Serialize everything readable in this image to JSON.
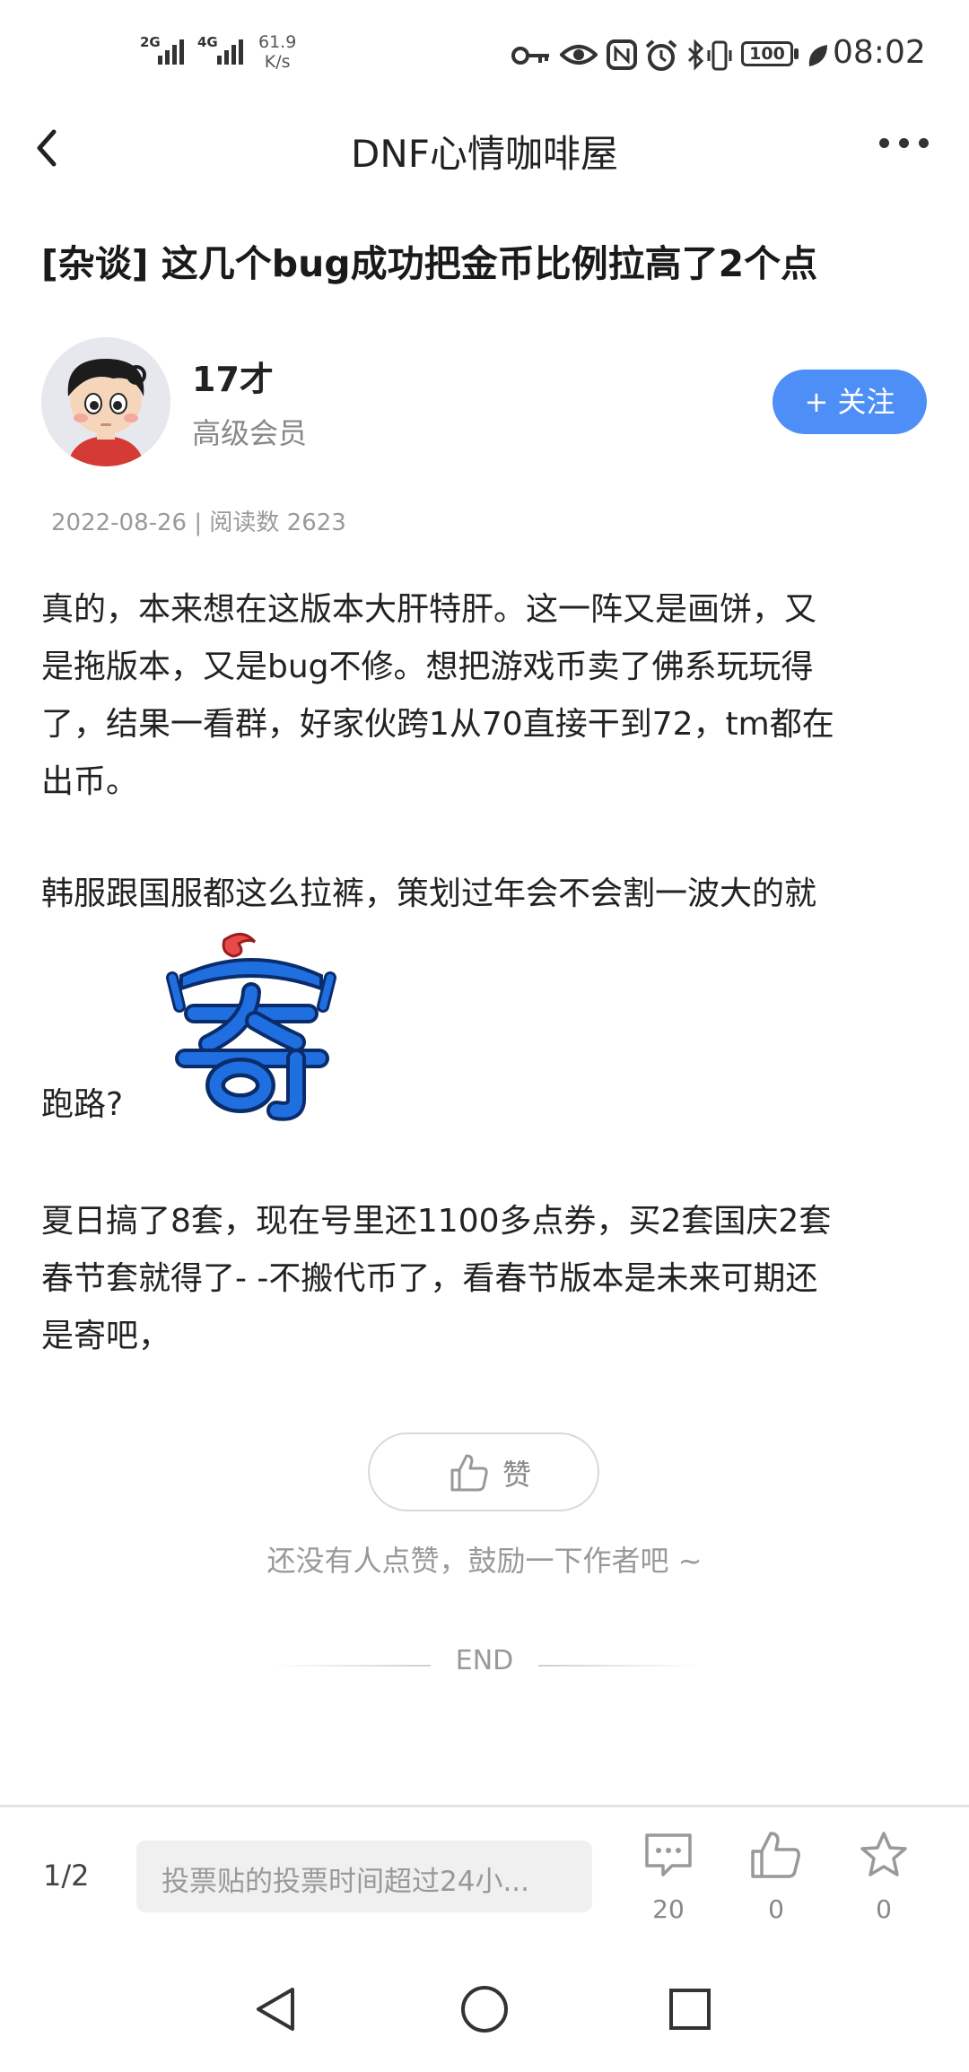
{
  "status_bar": {
    "signal1": "2G",
    "signal2": "4G",
    "net_speed_value": "61.9",
    "net_speed_unit": "K/s",
    "battery": "100",
    "time": "08:02",
    "icons": [
      "key-icon",
      "eye-icon",
      "nfc-icon",
      "alarm-icon",
      "bluetooth-icon",
      "vibrate-icon",
      "battery-icon",
      "leaf-icon"
    ]
  },
  "header": {
    "title": "DNF心情咖啡屋"
  },
  "post": {
    "title": "[杂谈] 这几个bug成功把金币比例拉高了2个点",
    "author": {
      "name": "17才",
      "rank": "高级会员"
    },
    "follow_label": "+ 关注",
    "meta": "2022-08-26 | 阅读数 2623",
    "body": {
      "p1_line1": "真的，本来想在这版本大肝特肝。这一阵又是画饼，又",
      "p1_line2": "是拖版本，又是bug不修。想把游戏币卖了佛系玩玩得",
      "p1_line3": "了，结果一看群，好家伙跨1从70直接干到72，tm都在",
      "p1_line4": "出币。",
      "p2_line1": "韩服跟国服都这么拉裤，策划过年会不会割一波大的就",
      "p2_line2": "跑路?",
      "sticker_text": "寄",
      "p3_line1": "夏日搞了8套，现在号里还1100多点券，买2套国庆2套",
      "p3_line2": "春节套就得了- -不搬代币了，看春节版本是未来可期还",
      "p3_line3": "是寄吧，"
    },
    "like_label": "赞",
    "like_hint": "还没有人点赞，鼓励一下作者吧 ~",
    "end_label": "END"
  },
  "bottom_bar": {
    "pager": "1/2",
    "comment_placeholder": "投票贴的投票时间超过24小...",
    "comments_count": "20",
    "likes_count": "0",
    "favorites_count": "0"
  },
  "colors": {
    "accent": "#4e8ef7",
    "sticker_blue": "#1f6fe0",
    "sticker_red": "#e84a4a"
  }
}
